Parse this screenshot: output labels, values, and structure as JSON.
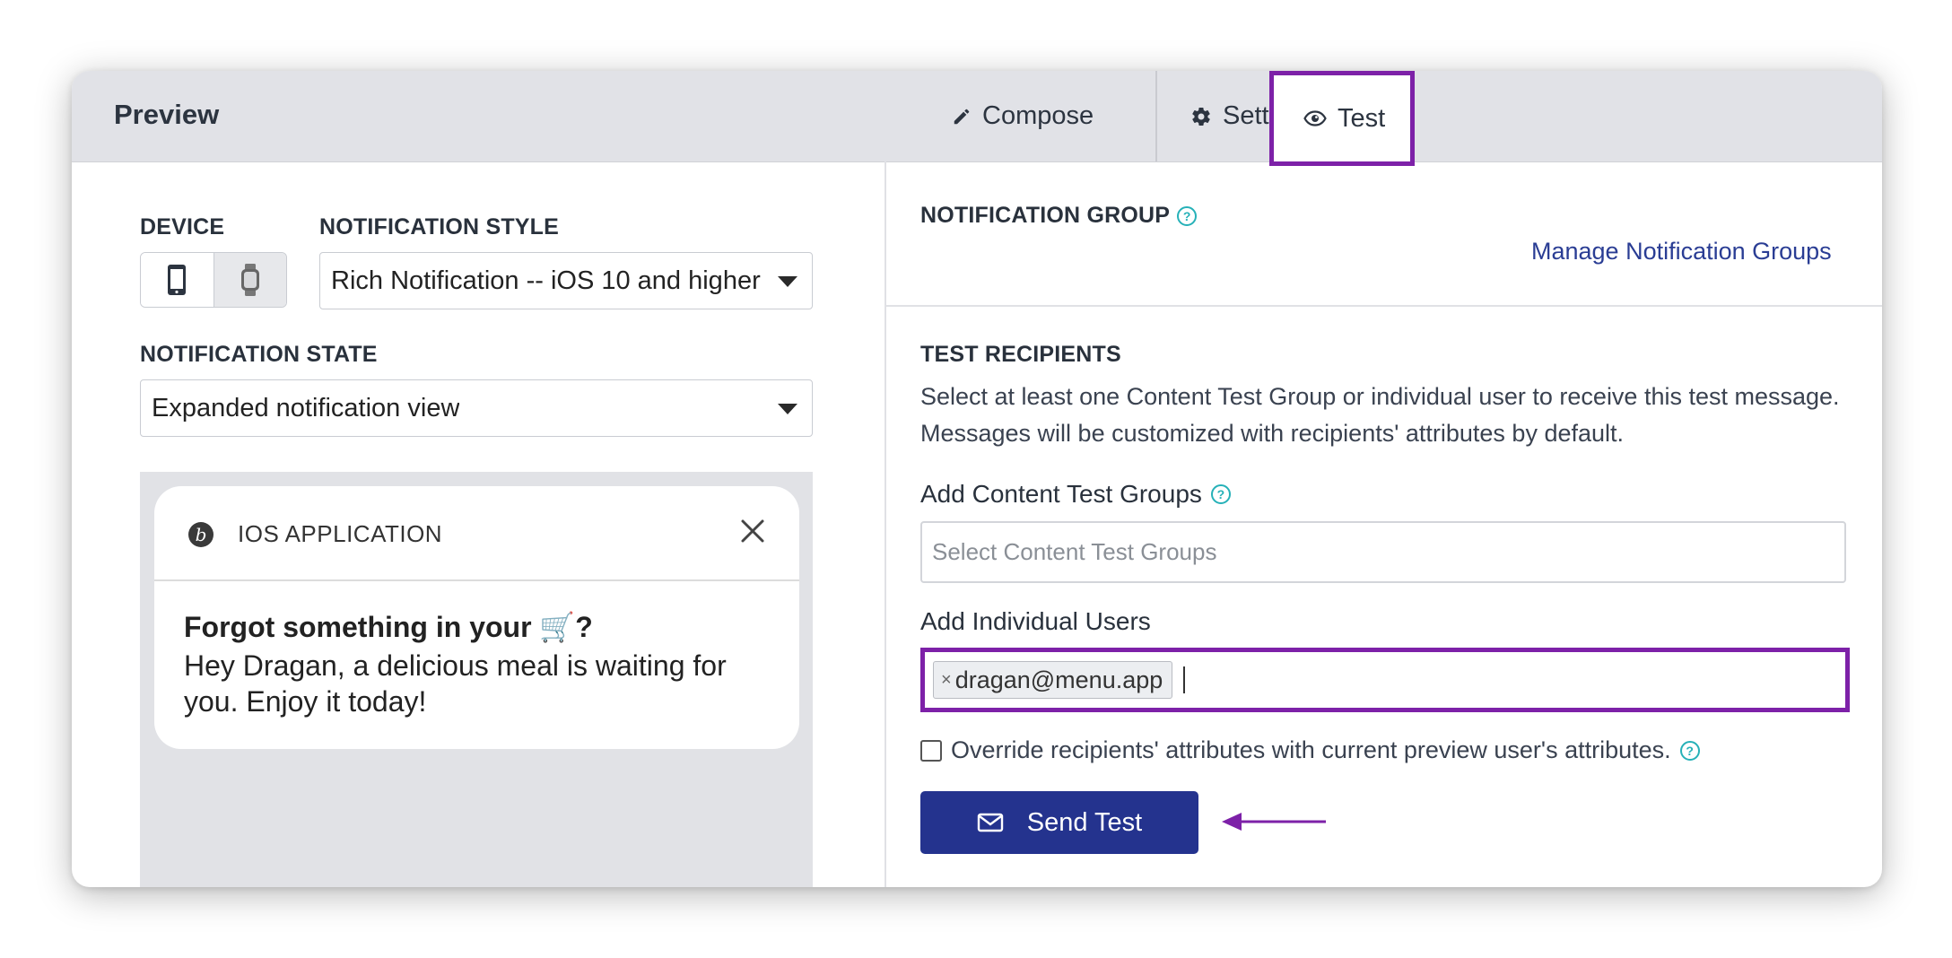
{
  "panel": {
    "title": "Preview"
  },
  "tabs": [
    {
      "label": "Compose",
      "icon": "pencil-icon"
    },
    {
      "label": "Settings",
      "icon": "gear-icon"
    },
    {
      "label": "Test",
      "icon": "eye-icon",
      "active": true
    }
  ],
  "left": {
    "device_label": "DEVICE",
    "devices": [
      "phone-icon",
      "watch-icon"
    ],
    "style_label": "NOTIFICATION STYLE",
    "style_value": "Rich Notification -- iOS 10 and higher",
    "state_label": "NOTIFICATION STATE",
    "state_value": "Expanded notification view",
    "notification": {
      "app_name": "IOS APPLICATION",
      "title": "Forgot something in your 🛒?",
      "body": "Hey Dragan, a delicious meal is waiting for you. Enjoy it today!"
    }
  },
  "right": {
    "group_label": "NOTIFICATION GROUP",
    "manage_link": "Manage Notification Groups",
    "recipients_label": "TEST RECIPIENTS",
    "recipients_desc": "Select at least one Content Test Group or individual user to receive this test message. Messages will be customized with recipients' attributes by default.",
    "content_groups_label": "Add Content Test Groups",
    "content_groups_placeholder": "Select Content Test Groups",
    "individual_users_label": "Add Individual Users",
    "users": [
      {
        "email": "dragan@menu.app",
        "remove": "×"
      }
    ],
    "override_label": "Override recipients' attributes with current preview user's attributes.",
    "send_button": "Send Test"
  },
  "colors": {
    "highlight": "#7d21a8",
    "primary_button": "#24338e",
    "link": "#2a3d94",
    "help_icon": "#26b1b8"
  }
}
